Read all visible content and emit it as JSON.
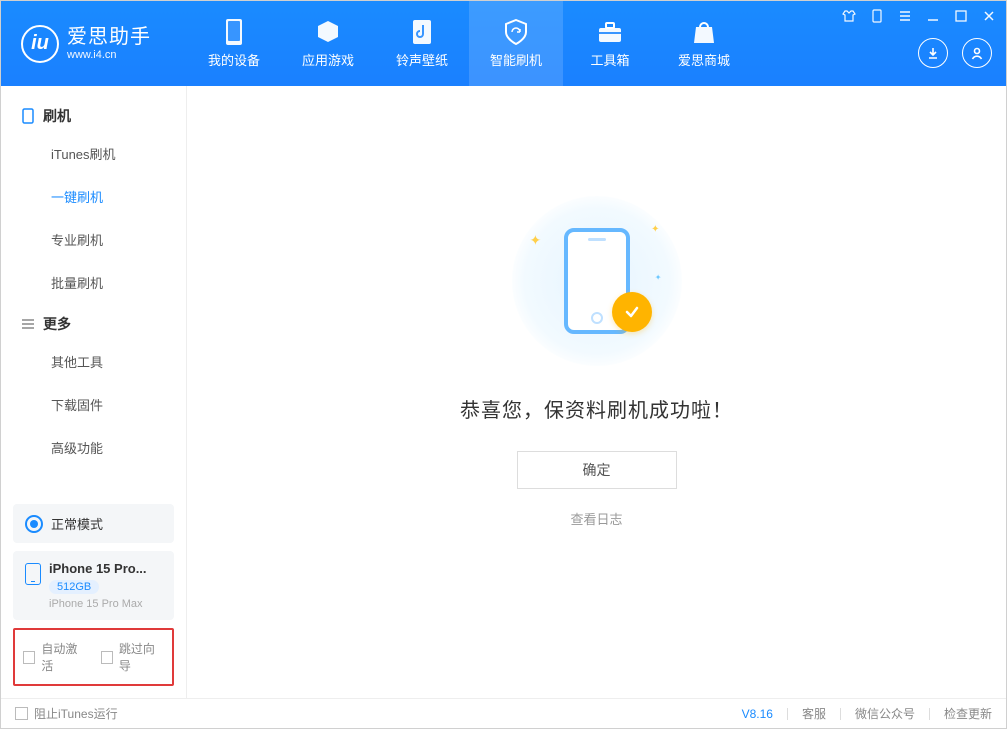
{
  "app": {
    "name_cn": "爱思助手",
    "url": "www.i4.cn"
  },
  "nav": {
    "items": [
      {
        "label": "我的设备"
      },
      {
        "label": "应用游戏"
      },
      {
        "label": "铃声壁纸"
      },
      {
        "label": "智能刷机"
      },
      {
        "label": "工具箱"
      },
      {
        "label": "爱思商城"
      }
    ],
    "active_index": 3
  },
  "sidebar": {
    "group1_title": "刷机",
    "group1_items": [
      "iTunes刷机",
      "一键刷机",
      "专业刷机",
      "批量刷机"
    ],
    "group1_active_index": 1,
    "group2_title": "更多",
    "group2_items": [
      "其他工具",
      "下载固件",
      "高级功能"
    ],
    "mode_label": "正常模式",
    "device": {
      "name": "iPhone 15 Pro...",
      "storage": "512GB",
      "sub": "iPhone 15 Pro Max"
    },
    "highlight_checks": [
      "自动激活",
      "跳过向导"
    ]
  },
  "main": {
    "success_title": "恭喜您，保资料刷机成功啦！",
    "ok_button": "确定",
    "log_link": "查看日志"
  },
  "footer": {
    "block_itunes": "阻止iTunes运行",
    "version": "V8.16",
    "links": [
      "客服",
      "微信公众号",
      "检查更新"
    ]
  }
}
